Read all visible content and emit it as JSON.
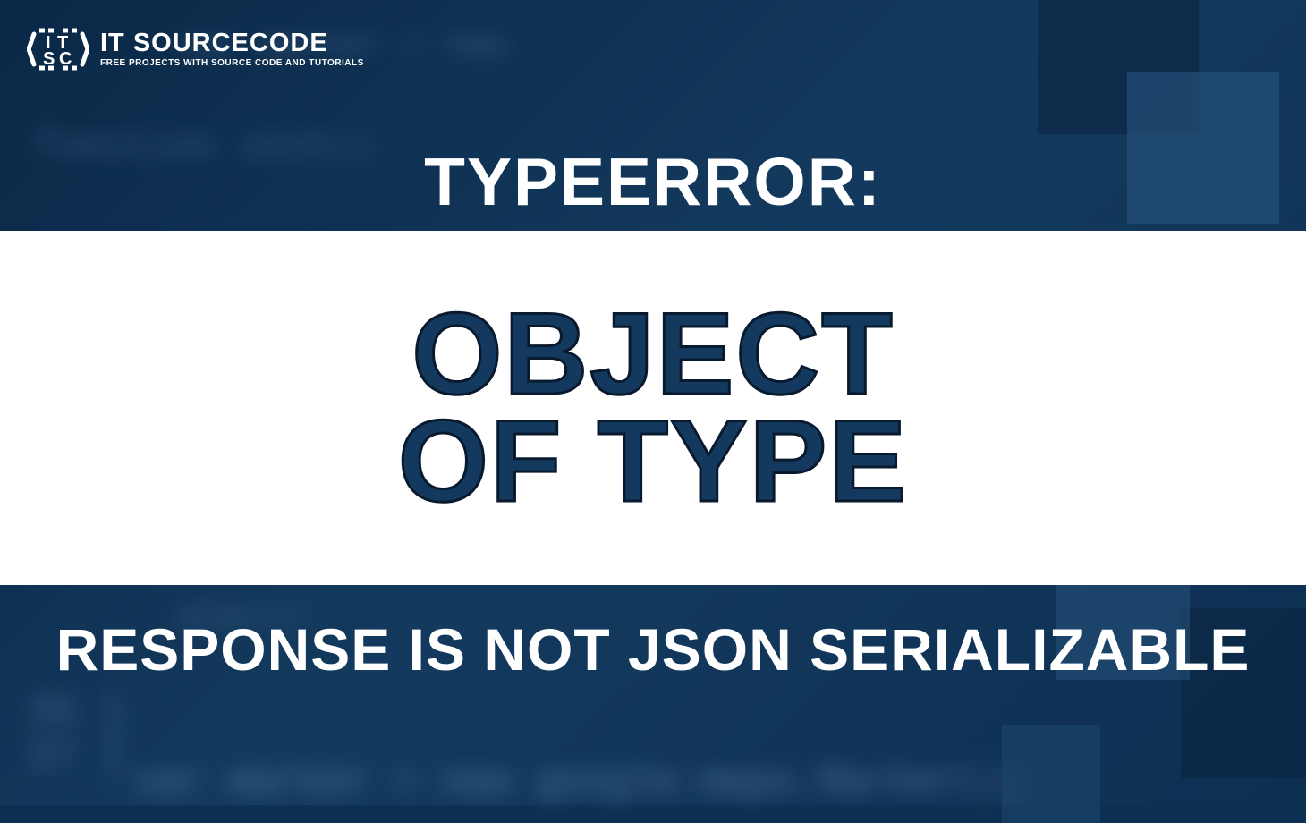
{
  "logo": {
    "title": "IT SOURCECODE",
    "subtitle": "FREE PROJECTS WITH SOURCE CODE AND TUTORIALS"
  },
  "heading": {
    "top": "TYPEERROR:",
    "main_line1": "OBJECT",
    "main_line2": "OF TYPE",
    "bottom": "RESPONSE IS NOT JSON SERIALIZABLE"
  },
  "code_fragments": {
    "line1": "var marker = new",
    "line2": "function init()",
    "line3": "alert('",
    "line4": "36  }",
    "line5": "37 }",
    "line6": "var marker = new google.maps.Marker();"
  }
}
